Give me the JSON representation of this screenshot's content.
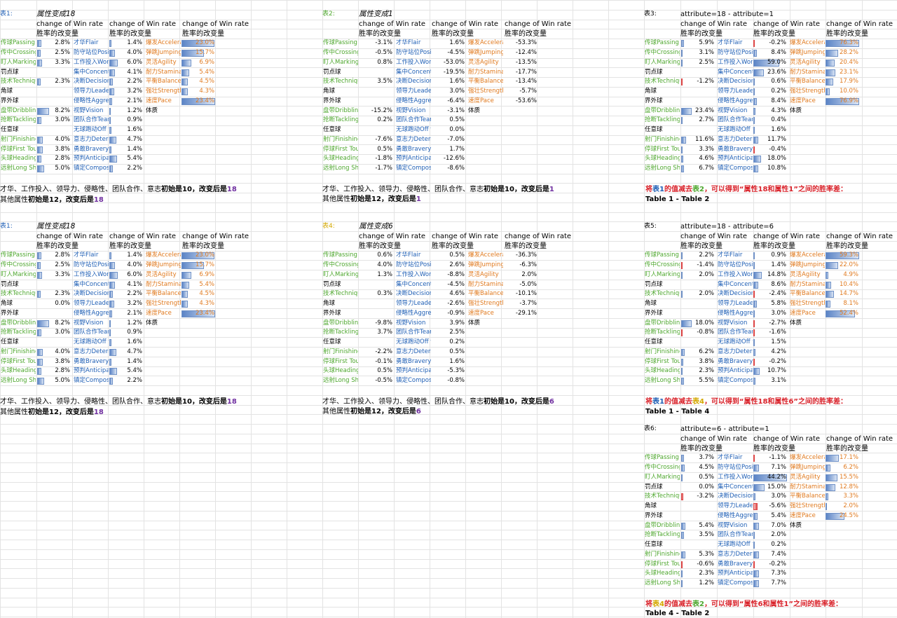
{
  "colors": {
    "green": "#4ea72e",
    "blue": "#1f5fb5",
    "orange": "#e07a1f",
    "purple": "#7030a0",
    "red": "#d9222a",
    "yellow": "#d4a800",
    "grey": "#000000"
  },
  "col_headers": {
    "line1": "change of Win rate",
    "line2": "胜率的改变量"
  },
  "attr_names": {
    "c1": [
      "传球Passing",
      "传中Crossing",
      "盯人Marking",
      "罚点球",
      "技术Technique",
      "角球",
      "界外球",
      "盘带Dribbling",
      "抢断Tackling",
      "任意球",
      "射门Finishing",
      "停球First Touch",
      "头球Heading",
      "远射Long Shots"
    ],
    "c1_colors": [
      "green",
      "green",
      "green",
      "grey",
      "green",
      "grey",
      "grey",
      "green",
      "green",
      "grey",
      "green",
      "green",
      "green",
      "green"
    ],
    "c2": [
      "才华Flair",
      "防守站位Positioning",
      "工作投入Work Rate",
      "集中Concentration",
      "决断Decisions",
      "领导力Leadership",
      "侵略性Aggression",
      "视野Vision",
      "团队合作Teamwork",
      "无球跑动Off the Ball",
      "意志力Determination",
      "勇敢Bravery",
      "预判Anticipation",
      "镇定Composure"
    ],
    "c3": [
      "爆发Acceleration",
      "弹跳Jumping Reach",
      "灵活Agility",
      "耐力Stamina",
      "平衡Balance",
      "强壮Strength",
      "速度Pace",
      "体质"
    ],
    "c3_colors": [
      "orange",
      "orange",
      "orange",
      "orange",
      "orange",
      "orange",
      "orange",
      "grey"
    ]
  },
  "tables": [
    {
      "label": "表1:",
      "label_color": "blue",
      "title": "属性变成18",
      "title_italic": true,
      "scale": 23.4,
      "c1": [
        2.8,
        2.5,
        3.3,
        null,
        2.3,
        null,
        null,
        8.2,
        3.0,
        null,
        4.0,
        3.8,
        2.8,
        5.0
      ],
      "c2": [
        1.4,
        4.0,
        6.0,
        4.1,
        2.2,
        3.2,
        2.1,
        1.2,
        0.9,
        1.6,
        4.7,
        1.4,
        5.4,
        2.2
      ],
      "c3": [
        23.0,
        15.7,
        6.9,
        5.4,
        4.5,
        4.3,
        23.4
      ]
    },
    {
      "label": "表2:",
      "label_color": "green",
      "title": "属性变成1",
      "title_italic": true,
      "scale": 0,
      "c1": [
        -3.1,
        -0.5,
        0.8,
        null,
        3.5,
        null,
        null,
        -15.2,
        0.2,
        null,
        -7.6,
        0.5,
        -1.8,
        -1.7
      ],
      "c2": [
        1.6,
        -4.5,
        -53.0,
        -19.5,
        1.6,
        3.0,
        -6.4,
        -3.1,
        0.5,
        0.0,
        -7.0,
        1.7,
        -12.6,
        -8.6
      ],
      "c3": [
        -53.3,
        -12.4,
        -13.5,
        -17.7,
        -13.4,
        -5.7,
        -53.6
      ]
    },
    {
      "label": "表3:",
      "label_color": "grey",
      "title": "attribute=18 - attribute=1",
      "title_italic": false,
      "scale": 76.9,
      "c1": [
        5.9,
        3.1,
        2.5,
        null,
        -1.2,
        null,
        null,
        23.4,
        2.7,
        null,
        11.6,
        3.3,
        4.6,
        6.7
      ],
      "c2": [
        -0.2,
        8.4,
        59.0,
        23.6,
        0.6,
        0.2,
        8.4,
        4.3,
        0.4,
        1.6,
        11.7,
        -0.4,
        18.0,
        10.8
      ],
      "c3": [
        76.3,
        28.2,
        20.4,
        23.1,
        17.9,
        10.0,
        76.9
      ]
    },
    {
      "label": "表1:",
      "label_color": "blue",
      "title": "属性变成18",
      "title_italic": true,
      "scale": 23.4,
      "c1": [
        2.8,
        2.5,
        3.3,
        null,
        2.3,
        0.0,
        null,
        8.2,
        3.0,
        null,
        4.0,
        3.8,
        2.8,
        5.0
      ],
      "c2": [
        1.4,
        4.0,
        6.0,
        4.1,
        2.2,
        3.2,
        2.1,
        1.2,
        0.9,
        1.6,
        4.7,
        1.4,
        5.4,
        2.2
      ],
      "c3": [
        23.0,
        15.7,
        6.9,
        5.4,
        4.5,
        4.3,
        23.4
      ]
    },
    {
      "label": "表4:",
      "label_color": "yellow",
      "title": "属性变成6",
      "title_italic": true,
      "scale": 0,
      "c1": [
        0.6,
        4.0,
        1.3,
        null,
        0.3,
        null,
        null,
        -9.8,
        3.7,
        null,
        -2.2,
        -0.1,
        0.5,
        -0.5
      ],
      "c2": [
        0.5,
        2.6,
        -8.8,
        -4.5,
        4.6,
        -2.6,
        -0.9,
        3.9,
        2.5,
        0.2,
        0.5,
        1.6,
        -5.3,
        -0.8
      ],
      "c3": [
        -36.3,
        -6.3,
        2.0,
        -5.0,
        -10.1,
        -3.7,
        -29.1
      ]
    },
    {
      "label": "表5:",
      "label_color": "grey",
      "title": "attribute=18 - attribute=6",
      "title_italic": false,
      "scale": 59.3,
      "c1": [
        2.2,
        -1.4,
        2.0,
        null,
        2.0,
        null,
        null,
        18.0,
        -0.8,
        null,
        6.2,
        3.8,
        2.3,
        5.5
      ],
      "c2": [
        0.9,
        1.4,
        14.8,
        8.6,
        -2.4,
        5.8,
        3.0,
        -2.7,
        -1.6,
        1.5,
        4.2,
        -0.2,
        10.7,
        3.1
      ],
      "c3": [
        59.3,
        22.0,
        4.9,
        10.4,
        14.7,
        8.1,
        52.4
      ]
    },
    {
      "label": "表6:",
      "label_color": "grey",
      "title": "attribute=6 - attribute=1",
      "title_italic": false,
      "scale": 44.2,
      "c1": [
        3.7,
        4.5,
        0.5,
        0.0,
        -3.2,
        null,
        null,
        5.4,
        3.5,
        null,
        5.3,
        -0.6,
        2.3,
        1.2
      ],
      "c2": [
        -1.1,
        7.1,
        44.2,
        15.0,
        3.0,
        -5.6,
        5.4,
        7.0,
        2.0,
        0.2,
        7.4,
        -0.2,
        7.3,
        7.7
      ],
      "c3": [
        17.1,
        6.2,
        15.5,
        12.8,
        3.3,
        2.0,
        24.5
      ]
    }
  ],
  "notes": {
    "t1_line1_a": "才华、工作投入、领导力、侵略性、团队合作、意志",
    "t1_line1_b": "初始是10，改变后是",
    "t1_val": "18",
    "t1_line2_a": "其他属性",
    "t1_line2_b": "初始是12，改变后是",
    "t2_val": "1",
    "t4_val": "6",
    "t3_note_a": "将",
    "t3_note_b": "表1",
    "t3_note_c": "的值减去",
    "t3_note_d": "表2",
    "t3_note_e": "，可以得到“属性18和属性1”之间的胜率差：",
    "t3_sub": "Table 1 - Table 2",
    "t5_note_d": "表4",
    "t5_note_e": "，可以得到“属性18和属性6”之间的胜率差：",
    "t5_sub": "Table 1 - Table 4",
    "t6_note_b": "表4",
    "t6_note_d": "表2",
    "t6_note_e": "，可以得到“属性6和属性1”之间的胜率差：",
    "t6_sub": "Table 4 - Table 2"
  }
}
